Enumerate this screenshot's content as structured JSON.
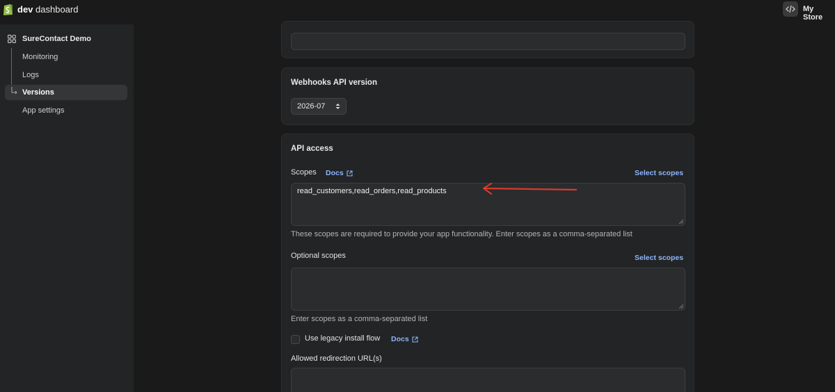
{
  "topbar": {
    "title_bold": "dev",
    "title_rest": "dashboard",
    "store_name": "My Store"
  },
  "sidebar": {
    "app_name": "SureContact Demo",
    "items": [
      {
        "label": "Monitoring"
      },
      {
        "label": "Logs"
      },
      {
        "label": "Versions"
      },
      {
        "label": "App settings"
      }
    ]
  },
  "webhooks": {
    "title": "Webhooks API version",
    "version": "2026-07"
  },
  "api_access": {
    "title": "API access",
    "scopes_label": "Scopes",
    "docs_label": "Docs",
    "select_scopes": "Select scopes",
    "scopes_value": "read_customers,read_orders,read_products",
    "scopes_help": "These scopes are required to provide your app functionality. Enter scopes as a comma-separated list",
    "optional_label": "Optional scopes",
    "optional_select": "Select scopes",
    "optional_help": "Enter scopes as a comma-separated list",
    "legacy_label": "Use legacy install flow",
    "legacy_docs": "Docs",
    "redirect_label": "Allowed redirection URL(s)"
  },
  "colors": {
    "accent_link": "#8fb4ff",
    "annotation_arrow": "#d93a2b"
  }
}
